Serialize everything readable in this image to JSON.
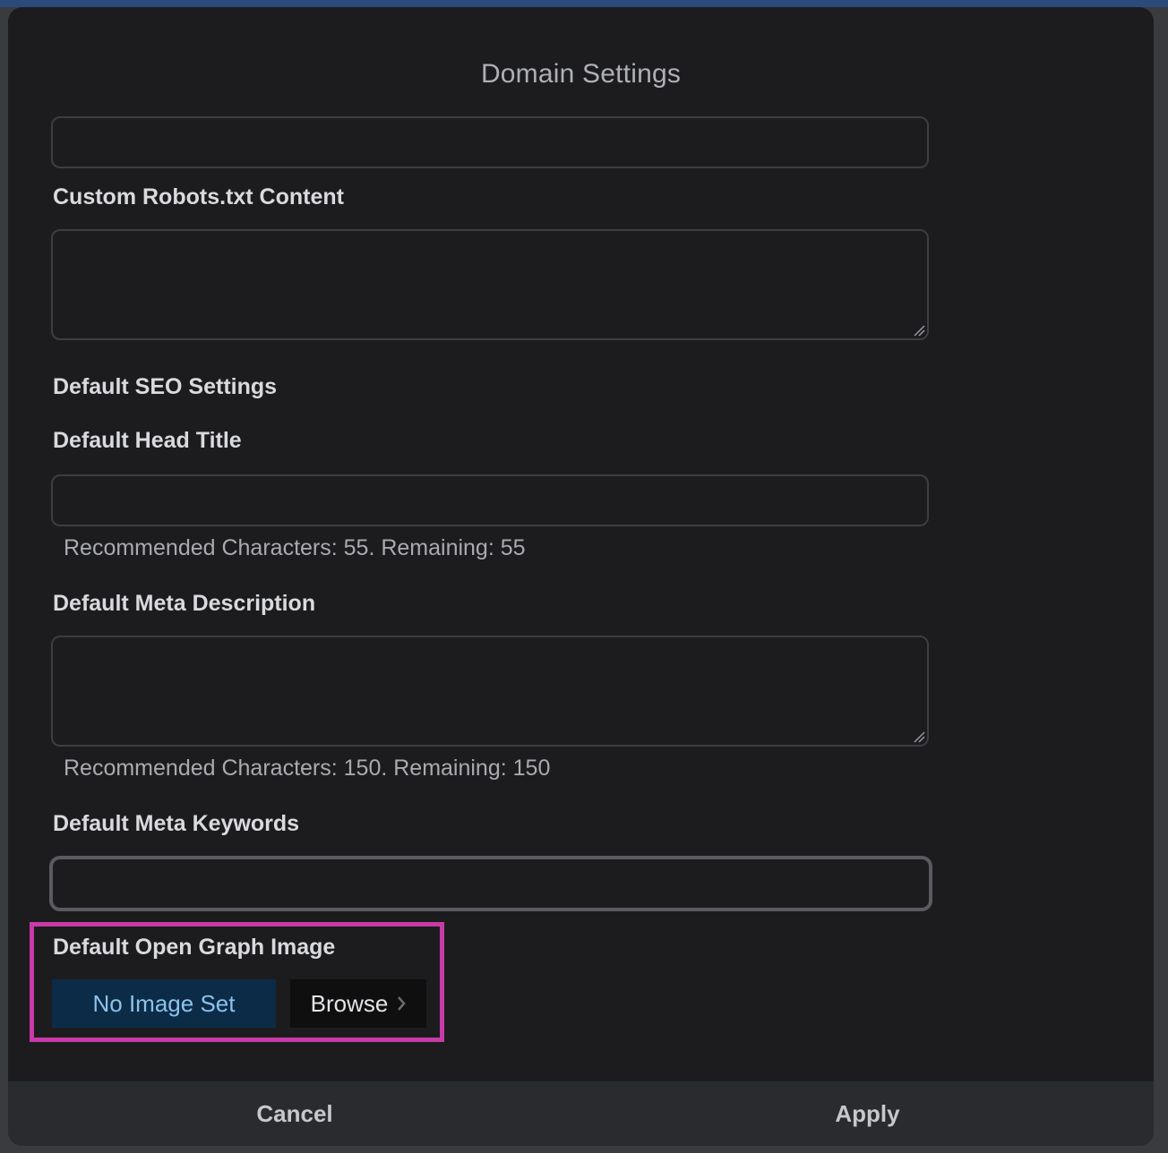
{
  "modal": {
    "title": "Domain Settings"
  },
  "fields": {
    "top_input_value": "",
    "robots_label": "Custom Robots.txt Content",
    "robots_value": "",
    "seo_section_label": "Default SEO Settings",
    "head_title_label": "Default Head Title",
    "head_title_value": "",
    "head_title_hint": "Recommended Characters: 55. Remaining: 55",
    "meta_description_label": "Default Meta Description",
    "meta_description_value": "",
    "meta_description_hint": "Recommended Characters: 150. Remaining: 150",
    "meta_keywords_label": "Default Meta Keywords",
    "meta_keywords_value": "",
    "og_image_label": "Default Open Graph Image",
    "og_image_status": "No Image Set",
    "browse_label": "Browse"
  },
  "footer": {
    "cancel_label": "Cancel",
    "apply_label": "Apply"
  },
  "icons": {
    "browse_chevron": "chevron-right-icon",
    "resize_handle": "resize-grip-icon"
  },
  "colors": {
    "highlight": "#c93aa6",
    "no_image_bg": "#0c2b47",
    "no_image_text": "#8cc3ea"
  }
}
